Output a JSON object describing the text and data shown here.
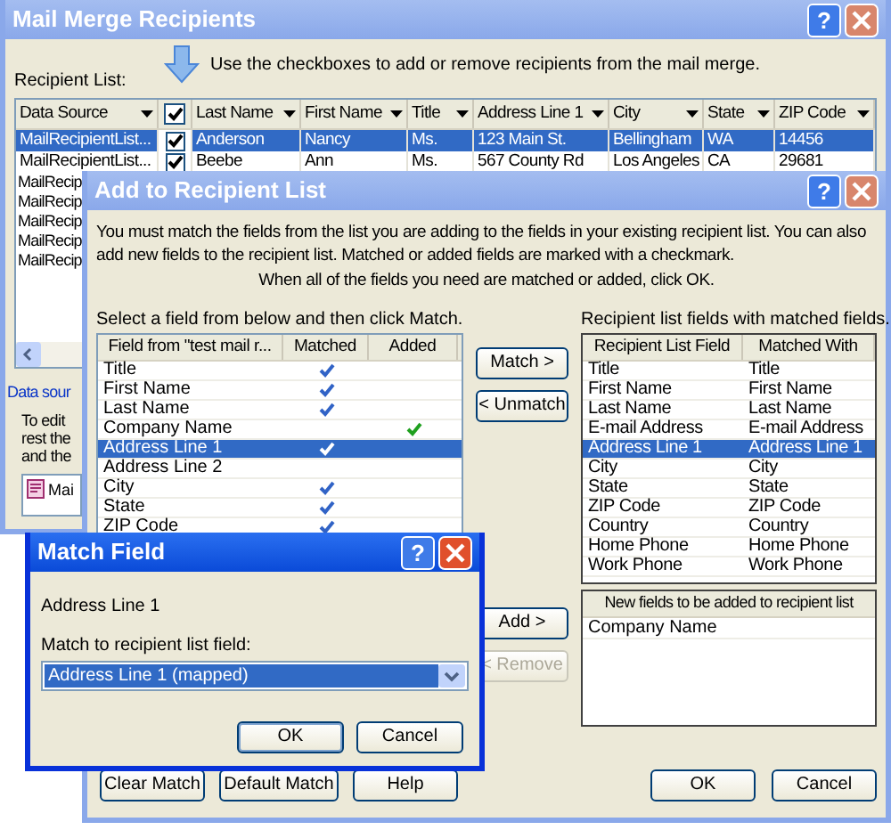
{
  "mail_merge_recipients": {
    "title": "Mail Merge Recipients",
    "help_button": "?",
    "instruction": "Use the checkboxes to add or remove recipients from the mail merge.",
    "list_label": "Recipient List:",
    "header_checked": true,
    "columns": [
      "Data Source",
      "Last Name",
      "First Name",
      "Title",
      "Address Line 1",
      "City",
      "State",
      "ZIP Code"
    ],
    "rows": [
      {
        "selected": true,
        "checked": true,
        "cells": [
          "MailRecipientList...",
          "Anderson",
          "Nancy",
          "Ms.",
          "123 Main St.",
          "Bellingham",
          "WA",
          "14456"
        ]
      },
      {
        "selected": false,
        "checked": true,
        "cells": [
          "MailRecipientList...",
          "Beebe",
          "Ann",
          "Ms.",
          "567 County Rd",
          "Los Angeles",
          "CA",
          "29681"
        ]
      }
    ],
    "more_rows": [
      "MailRecip",
      "MailRecip",
      "MailRecip",
      "MailRecip",
      "MailRecip"
    ],
    "data_source_link": "Data sour",
    "edit_lines": [
      "To edit",
      "rest the",
      "and the"
    ],
    "source_item": "Mai"
  },
  "add_to_recipient_list": {
    "title": "Add to Recipient List",
    "help_button": "?",
    "intro": "You must match the fields from the list you are adding to the fields in your existing recipient list. You can also add new fields to the recipient list. Matched or added fields are marked with a checkmark.",
    "hint": "When all of the fields you need are matched or added, click OK.",
    "select_label": "Select a field from below and then click Match.",
    "left_columns": [
      "Field from \"test mail r...",
      "Matched",
      "Added"
    ],
    "left_rows": [
      {
        "field": "Title",
        "matched": true,
        "added": false,
        "selected": false
      },
      {
        "field": "First Name",
        "matched": true,
        "added": false,
        "selected": false
      },
      {
        "field": "Last Name",
        "matched": true,
        "added": false,
        "selected": false
      },
      {
        "field": "Company Name",
        "matched": false,
        "added": true,
        "selected": false
      },
      {
        "field": "Address Line 1",
        "matched": true,
        "added": false,
        "selected": true
      },
      {
        "field": "Address Line 2",
        "matched": false,
        "added": false,
        "selected": false
      },
      {
        "field": "City",
        "matched": true,
        "added": false,
        "selected": false
      },
      {
        "field": "State",
        "matched": true,
        "added": false,
        "selected": false
      },
      {
        "field": "ZIP Code",
        "matched": true,
        "added": false,
        "selected": false
      }
    ],
    "match_buttons": [
      {
        "label": "Match >",
        "disabled": false
      },
      {
        "label": "< Unmatch",
        "disabled": false
      }
    ],
    "add_buttons": [
      {
        "label": "Add >",
        "disabled": false
      },
      {
        "label": "< Remove",
        "disabled": true
      }
    ],
    "right_label": "Recipient list fields with matched fields.",
    "right_columns": [
      "Recipient List Field",
      "Matched With"
    ],
    "right_rows": [
      {
        "field": "Title",
        "matched_with": "Title",
        "selected": false
      },
      {
        "field": "First Name",
        "matched_with": "First Name",
        "selected": false
      },
      {
        "field": "Last Name",
        "matched_with": "Last Name",
        "selected": false
      },
      {
        "field": "E-mail Address",
        "matched_with": "E-mail Address",
        "selected": false
      },
      {
        "field": "Address Line 1",
        "matched_with": "Address Line 1",
        "selected": true
      },
      {
        "field": "City",
        "matched_with": "City",
        "selected": false
      },
      {
        "field": "State",
        "matched_with": "State",
        "selected": false
      },
      {
        "field": "ZIP Code",
        "matched_with": "ZIP Code",
        "selected": false
      },
      {
        "field": "Country",
        "matched_with": "Country",
        "selected": false
      },
      {
        "field": "Home Phone",
        "matched_with": "Home Phone",
        "selected": false
      },
      {
        "field": "Work Phone",
        "matched_with": "Work Phone",
        "selected": false
      }
    ],
    "new_fields_header": "New fields to be added to recipient list",
    "new_fields": [
      "Company Name"
    ],
    "left_buttons": [
      "Clear Match",
      "Default Match",
      "Help"
    ],
    "right_buttons": [
      "OK",
      "Cancel"
    ]
  },
  "match_field": {
    "title": "Match Field",
    "help_button": "?",
    "field": "Address Line 1",
    "label": "Match to recipient list field:",
    "dropdown_value": "Address Line 1 (mapped)",
    "buttons": [
      "OK",
      "Cancel"
    ]
  }
}
